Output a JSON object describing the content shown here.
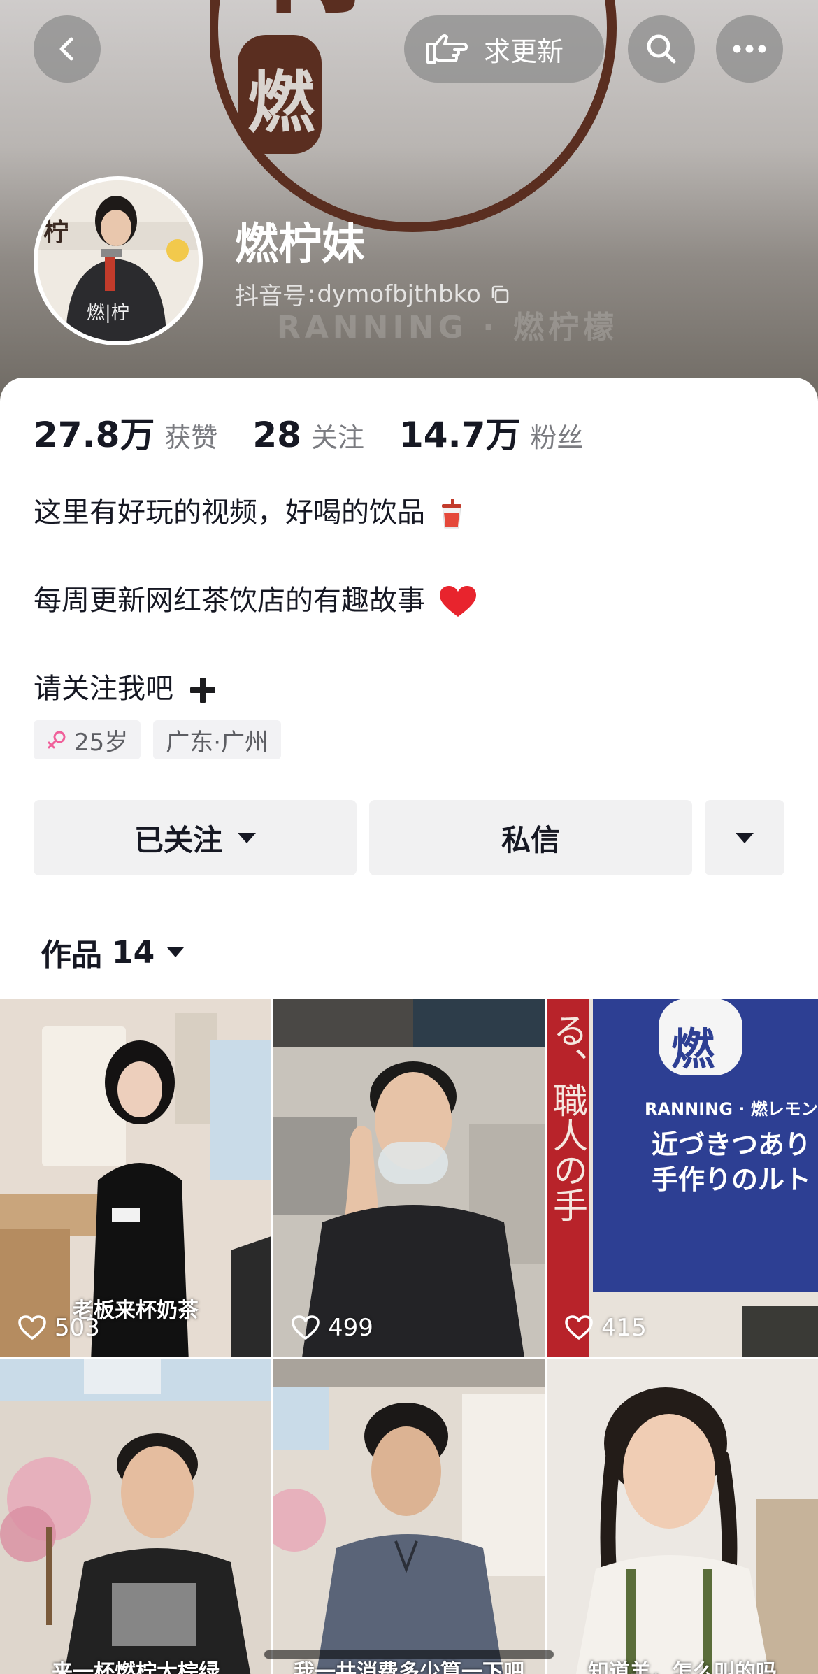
{
  "header": {
    "update_button_label": "求更新",
    "cover_tagline": "RANNING · 燃柠檬"
  },
  "profile": {
    "nickname": "燃柠妹",
    "douyin_id_label": "抖音号",
    "douyin_id_sep": ":",
    "douyin_id": "dymofbjthbko"
  },
  "stats": [
    {
      "value": "27.8万",
      "label": "获赞"
    },
    {
      "value": "28",
      "label": "关注"
    },
    {
      "value": "14.7万",
      "label": "粉丝"
    }
  ],
  "bio": {
    "line1": "这里有好玩的视频，好喝的饮品",
    "line2": "每周更新网红茶饮店的有趣故事",
    "line3": "请关注我吧"
  },
  "tags": {
    "age": "25岁",
    "location": "广东·广州"
  },
  "actions": {
    "followed_label": "已关注",
    "message_label": "私信"
  },
  "works": {
    "label": "作品",
    "count": "14"
  },
  "videos": [
    {
      "caption": "老板来杯奶茶",
      "likes": "503"
    },
    {
      "caption": "",
      "likes": "499"
    },
    {
      "caption": "",
      "likes": "415",
      "sign_brand": "RANNING · 燃レモン",
      "sign_line1": "近づきつあり",
      "sign_line2": "手作りのルト",
      "sign_side": "る、職人の手"
    },
    {
      "caption": "来一杯燃柠大棕绿",
      "likes": ""
    },
    {
      "caption": "我一共消费多少算一下吧",
      "likes": ""
    },
    {
      "caption": "知道羊，怎么叫的吗",
      "likes": ""
    }
  ],
  "colors": {
    "accent_red": "#fe2c55",
    "text_primary": "#161823",
    "text_secondary": "#7a7b80",
    "button_bg": "#f1f1f2",
    "brand_brown": "#5a2e20"
  }
}
